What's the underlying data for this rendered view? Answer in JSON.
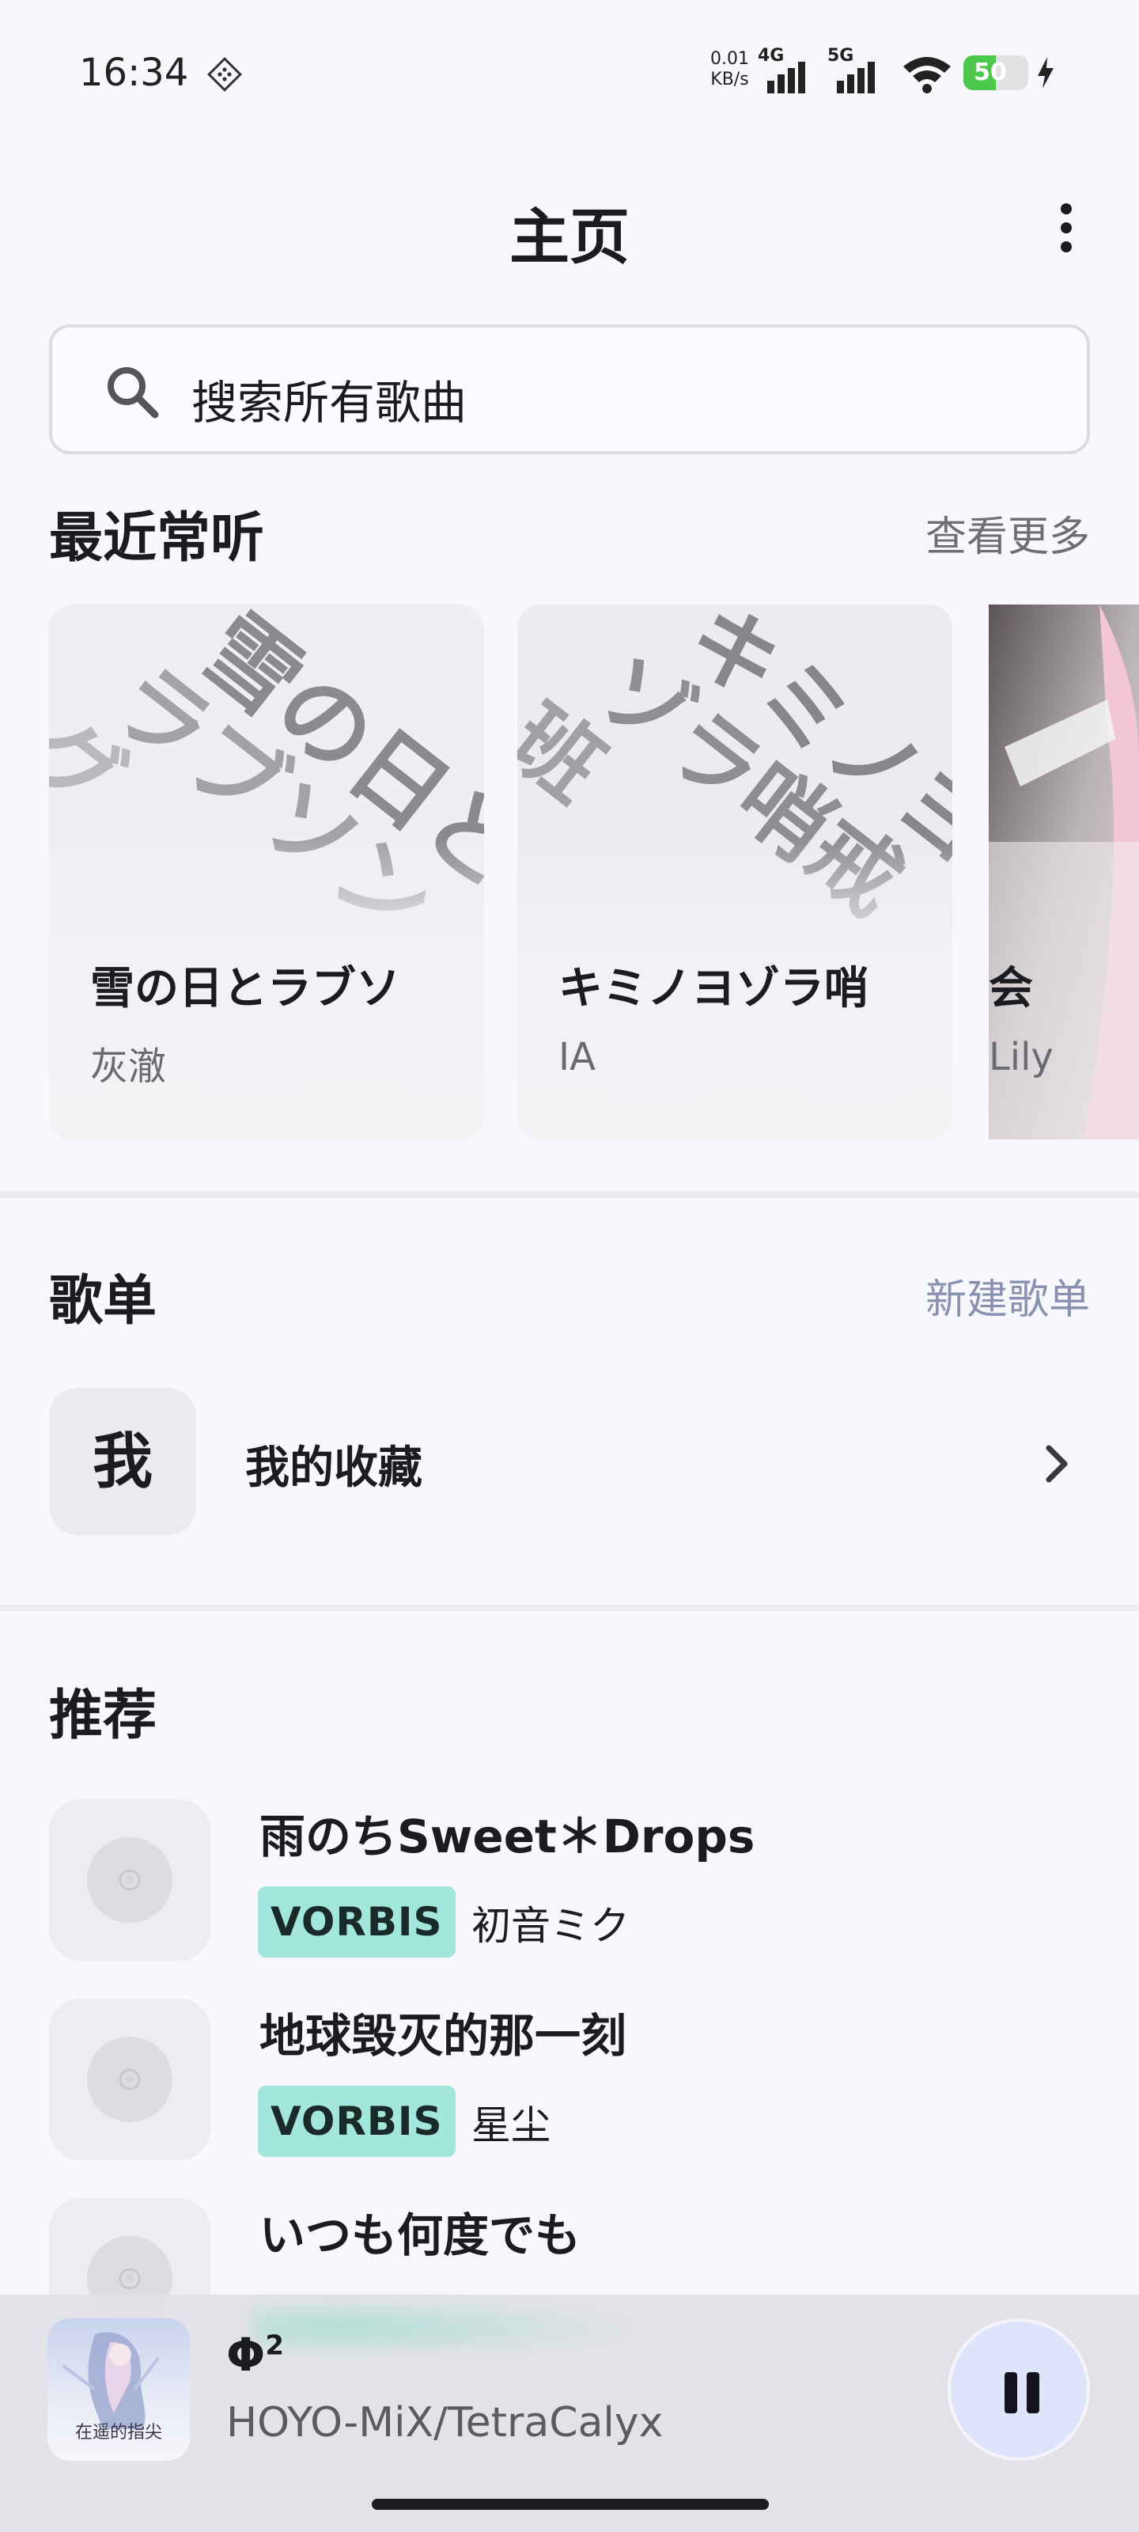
{
  "status_bar": {
    "time": "16:34",
    "net_speed_value": "0.01",
    "net_speed_unit": "KB/s",
    "signal_1_label": "4G",
    "signal_2_label": "5G",
    "battery_level": "50",
    "battery_fraction": 0.5,
    "battery_color": "#4cc94c"
  },
  "header": {
    "title": "主页",
    "more_icon": "more-vertical-icon"
  },
  "search": {
    "placeholder": "搜索所有歌曲",
    "icon": "search-icon"
  },
  "recent": {
    "title": "最近常听",
    "action": "查看更多",
    "cards": [
      {
        "title": "雪の日とラブソ",
        "artist": "灰澈",
        "art_text": [
          "雪の日と",
          "ラブソン",
          "グ"
        ]
      },
      {
        "title": "キミノヨゾラ哨",
        "artist": "IA",
        "art_text": [
          "キミノヨ",
          "ゾラ哨戒",
          "班"
        ]
      },
      {
        "title": "会",
        "artist": "Lily"
      }
    ]
  },
  "playlists": {
    "title": "歌单",
    "action": "新建歌单",
    "action_color": "#8a92b2",
    "items": [
      {
        "avatar": "我",
        "name": "我的收藏"
      }
    ]
  },
  "recommend": {
    "title": "推荐",
    "tag_color": "#a3e6dc",
    "tracks": [
      {
        "title": "雨のちSweet＊Drops",
        "tag": "VORBIS",
        "artist": "初音ミク"
      },
      {
        "title": "地球毁灭的那一刻",
        "tag": "VORBIS",
        "artist": "星尘"
      },
      {
        "title": "いつも何度でも",
        "tag": "",
        "artist": ""
      }
    ]
  },
  "player": {
    "title": "Φ",
    "title_sup": "2",
    "artist": "HOYO-MiX/TetraCalyx",
    "cover_text": "在遥的指尖",
    "pause_icon": "pause-icon"
  }
}
